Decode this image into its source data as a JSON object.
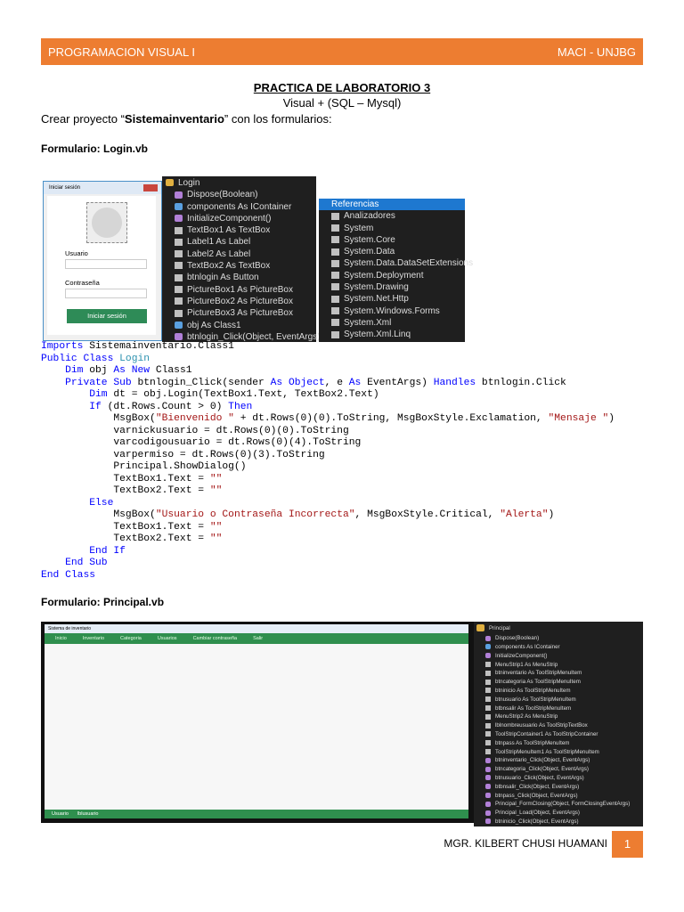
{
  "header": {
    "left": "PROGRAMACION VISUAL I",
    "right": "MACI - UNJBG"
  },
  "title": "PRACTICA DE LABORATORIO 3",
  "subtitle": "Visual + (SQL – Mysql)",
  "intro": {
    "pre": "Crear proyecto “",
    "bold": "Sistemainventario",
    "post": "” con los formularios:"
  },
  "form1_heading": "Formulario: Login.vb",
  "login_form": {
    "title": "Iniciar sesión",
    "user_label": "Usuario",
    "pass_label": "Contraseña",
    "button": "Iniciar sesión"
  },
  "login_members": {
    "root": "Login",
    "items": [
      "Dispose(Boolean)",
      "components As IContainer",
      "InitializeComponent()",
      "TextBox1 As TextBox",
      "Label1 As Label",
      "Label2 As Label",
      "TextBox2 As TextBox",
      "btnlogin As Button",
      "PictureBox1 As PictureBox",
      "PictureBox2 As PictureBox",
      "PictureBox3 As PictureBox",
      "obj As Class1",
      "btnlogin_Click(Object, EventArgs)"
    ],
    "kinds": [
      "m",
      "o",
      "m",
      "f",
      "f",
      "f",
      "f",
      "f",
      "f",
      "f",
      "f",
      "o",
      "m"
    ]
  },
  "references": {
    "root": "Referencias",
    "items": [
      "Analizadores",
      "System",
      "System.Core",
      "System.Data",
      "System.Data.DataSetExtensions",
      "System.Deployment",
      "System.Drawing",
      "System.Net.Http",
      "System.Windows.Forms",
      "System.Xml",
      "System.Xml.Linq"
    ]
  },
  "code": [
    [
      [
        "Imports ",
        "k"
      ],
      [
        "Sistemainventario.Class1",
        ""
      ]
    ],
    [
      [
        "Public Class ",
        "k"
      ],
      [
        "Login",
        "n"
      ]
    ],
    [
      [
        "    Dim ",
        "k"
      ],
      [
        "obj ",
        ""
      ],
      [
        "As New ",
        "k"
      ],
      [
        "Class1",
        ""
      ]
    ],
    [
      [
        "    Private Sub ",
        "k"
      ],
      [
        "btnlogin_Click(sender ",
        ""
      ],
      [
        "As Object",
        "k"
      ],
      [
        ", e ",
        ""
      ],
      [
        "As ",
        "k"
      ],
      [
        "EventArgs) ",
        ""
      ],
      [
        "Handles ",
        "k"
      ],
      [
        "btnlogin.Click",
        ""
      ]
    ],
    [
      [
        "        Dim ",
        "k"
      ],
      [
        "dt = obj.Login(TextBox1.Text, TextBox2.Text)",
        ""
      ]
    ],
    [
      [
        "        If ",
        "k"
      ],
      [
        "(dt.Rows.Count > 0) ",
        ""
      ],
      [
        "Then",
        "k"
      ]
    ],
    [
      [
        "            MsgBox(",
        ""
      ],
      [
        "\"Bienvenido \"",
        "s"
      ],
      [
        " + dt.Rows(0)(0).ToString, MsgBoxStyle.Exclamation, ",
        ""
      ],
      [
        "\"Mensaje \"",
        "s"
      ],
      [
        ")",
        ""
      ]
    ],
    [
      [
        "            varnickusuario = dt.Rows(0)(0).ToString",
        ""
      ]
    ],
    [
      [
        "            varcodigousuario = dt.Rows(0)(4).ToString",
        ""
      ]
    ],
    [
      [
        "            varpermiso = dt.Rows(0)(3).ToString",
        ""
      ]
    ],
    [
      [
        "            Principal.ShowDialog()",
        ""
      ]
    ],
    [
      [
        "            TextBox1.Text = ",
        ""
      ],
      [
        "\"\"",
        "s"
      ]
    ],
    [
      [
        "            TextBox2.Text = ",
        ""
      ],
      [
        "\"\"",
        "s"
      ]
    ],
    [
      [
        "        Else",
        "k"
      ]
    ],
    [
      [
        "            MsgBox(",
        ""
      ],
      [
        "\"Usuario o Contraseña Incorrecta\"",
        "s"
      ],
      [
        ", MsgBoxStyle.Critical, ",
        ""
      ],
      [
        "\"Alerta\"",
        "s"
      ],
      [
        ")",
        ""
      ]
    ],
    [
      [
        "            TextBox1.Text = ",
        ""
      ],
      [
        "\"\"",
        "s"
      ]
    ],
    [
      [
        "            TextBox2.Text = ",
        ""
      ],
      [
        "\"\"",
        "s"
      ]
    ],
    [
      [
        "        End If",
        "k"
      ]
    ],
    [
      [
        "    End Sub",
        "k"
      ]
    ],
    [
      [
        "End Class",
        "k"
      ]
    ]
  ],
  "form2_heading": "Formulario: Principal.vb",
  "principal_form": {
    "title": "Sistema de inventario",
    "menu": [
      "Inicio",
      "Inventario",
      "Categoria",
      "Usuarios",
      "Cambiar contraseña",
      "Salir"
    ],
    "status": [
      "Usuario",
      "lblusuario"
    ]
  },
  "principal_members": {
    "root": "Principal",
    "items": [
      "Dispose(Boolean)",
      "components As IContainer",
      "InitializeComponent()",
      "MenuStrip1 As MenuStrip",
      "btninventario As ToolStripMenuItem",
      "btncategoria As ToolStripMenuItem",
      "btninicio As ToolStripMenuItem",
      "btnusuario As ToolStripMenuItem",
      "btbnsalir As ToolStripMenuItem",
      "MenuStrip2 As MenuStrip",
      "lblnombreusuario As ToolStripTextBox",
      "ToolStripContainer1 As ToolStripContainer",
      "btnpass As ToolStripMenuItem",
      "ToolStripMenuItem1 As ToolStripMenuItem",
      "btninventario_Click(Object, EventArgs)",
      "btncategoria_Click(Object, EventArgs)",
      "btnusuario_Click(Object, EventArgs)",
      "btbnsalir_Click(Object, EventArgs)",
      "btnpass_Click(Object, EventArgs)",
      "Principal_FormClosing(Object, FormClosingEventArgs)",
      "Principal_Load(Object, EventArgs)",
      "btninicio_Click(Object, EventArgs)"
    ],
    "kinds": [
      "m",
      "o",
      "m",
      "f",
      "f",
      "f",
      "f",
      "f",
      "f",
      "f",
      "f",
      "f",
      "f",
      "f",
      "m",
      "m",
      "m",
      "m",
      "m",
      "m",
      "m",
      "m"
    ]
  },
  "footer": {
    "author": "MGR. KILBERT CHUSI HUAMANI",
    "page": "1"
  }
}
